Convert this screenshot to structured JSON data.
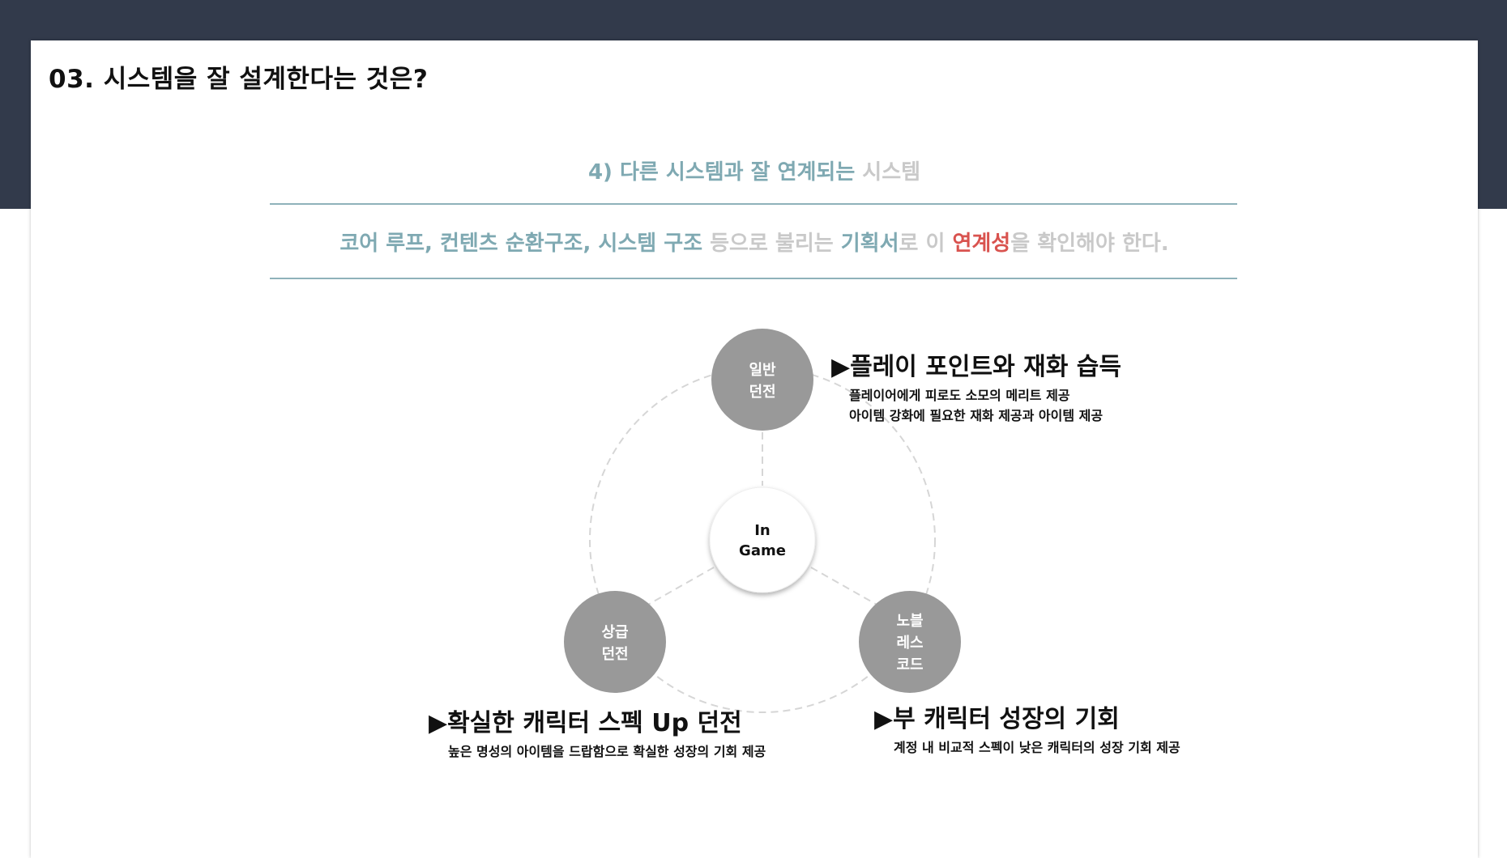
{
  "page_title": "03. 시스템을 잘 설계한다는 것은?",
  "subtitle": {
    "part1": "4) 다른 시스템과 잘 연계되는 ",
    "part2": "시스템"
  },
  "summary": {
    "part1": "코어 루프, 컨텐츠 순환구조, 시스템 구조 ",
    "part2": "등으로 불리는 ",
    "part3": "기획서",
    "part4": "로 이 ",
    "part5": "연계성",
    "part6": "을 확인해야 한다."
  },
  "diagram": {
    "center": {
      "line1": "In",
      "line2": "Game"
    },
    "nodes": {
      "general_dungeon": {
        "line1": "일반",
        "line2": "던전"
      },
      "premium_dungeon": {
        "line1": "상급",
        "line2": "던전"
      },
      "noblesse_code": {
        "line1": "노블",
        "line2": "레스",
        "line3": "코드"
      }
    },
    "callouts": {
      "general_dungeon": {
        "heading": "▶플레이 포인트와 재화 습득",
        "lines": [
          "플레이어에게 피로도 소모의 메리트 제공",
          "아이템 강화에 필요한 재화 제공과 아이템 제공"
        ]
      },
      "premium_dungeon": {
        "heading": "▶확실한 캐릭터 스펙 Up 던전",
        "lines": [
          "높은 명성의 아이템을 드랍함으로 확실한 성장의 기회 제공"
        ]
      },
      "noblesse_code": {
        "heading": "▶부 캐릭터 성장의 기회",
        "lines": [
          "계정 내 비교적 스펙이 낮은 캐릭터의 성장 기회 제공"
        ]
      }
    },
    "colors": {
      "node_fill": "#999999",
      "ring_stroke": "#d6d6d6",
      "accent_teal": "#7fa9b2",
      "accent_red": "#d9534f"
    }
  }
}
